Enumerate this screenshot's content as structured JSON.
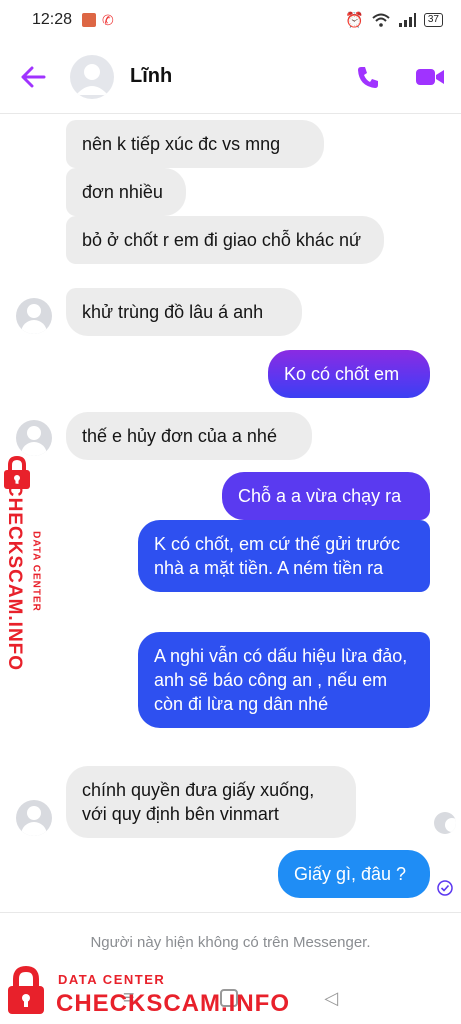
{
  "status": {
    "time": "12:28",
    "battery": "37"
  },
  "header": {
    "name": "Lĩnh"
  },
  "messages": [
    {
      "side": "in",
      "text": "nên k tiếp xúc đc vs mng"
    },
    {
      "side": "in",
      "text": "đơn nhiều"
    },
    {
      "side": "in",
      "text": "bỏ ở chốt r em đi giao chỗ khác nứ"
    },
    {
      "side": "in",
      "text": "khử trùng đồ lâu á anh"
    },
    {
      "side": "out",
      "text": "Ko có chốt em"
    },
    {
      "side": "in",
      "text": "thế e hủy đơn của a nhé"
    },
    {
      "side": "out",
      "text": "Chỗ a a vừa chạy ra"
    },
    {
      "side": "out",
      "text": "K có chốt, em cứ thế gửi trước nhà a mặt tiền. A ném tiền ra"
    },
    {
      "side": "out",
      "text": "A nghi vẫn có dấu hiệu lừa đảo, anh sẽ báo công an , nếu em còn đi lừa ng dân nhé"
    },
    {
      "side": "in",
      "text": "chính quyền đưa giấy xuống, với quy định bên vinmart"
    },
    {
      "side": "out",
      "text": "Giấy gì, đâu ?"
    }
  ],
  "footer": {
    "notice": "Người này hiện không có trên Messenger."
  },
  "watermark": {
    "line1": "DATA CENTER",
    "line2": "CHECKSCAM.INFO"
  },
  "icons": [
    "back-arrow-icon",
    "phone-icon",
    "video-icon",
    "wifi-icon",
    "signal-icon",
    "alarm-icon",
    "seen-check-icon"
  ],
  "colors": {
    "accent": "#a033ff",
    "outgoing_purple": "#7b2ff7",
    "outgoing_blue": "#2e50f0",
    "incoming_gray": "#ececec",
    "watermark_red": "#e8212b"
  }
}
